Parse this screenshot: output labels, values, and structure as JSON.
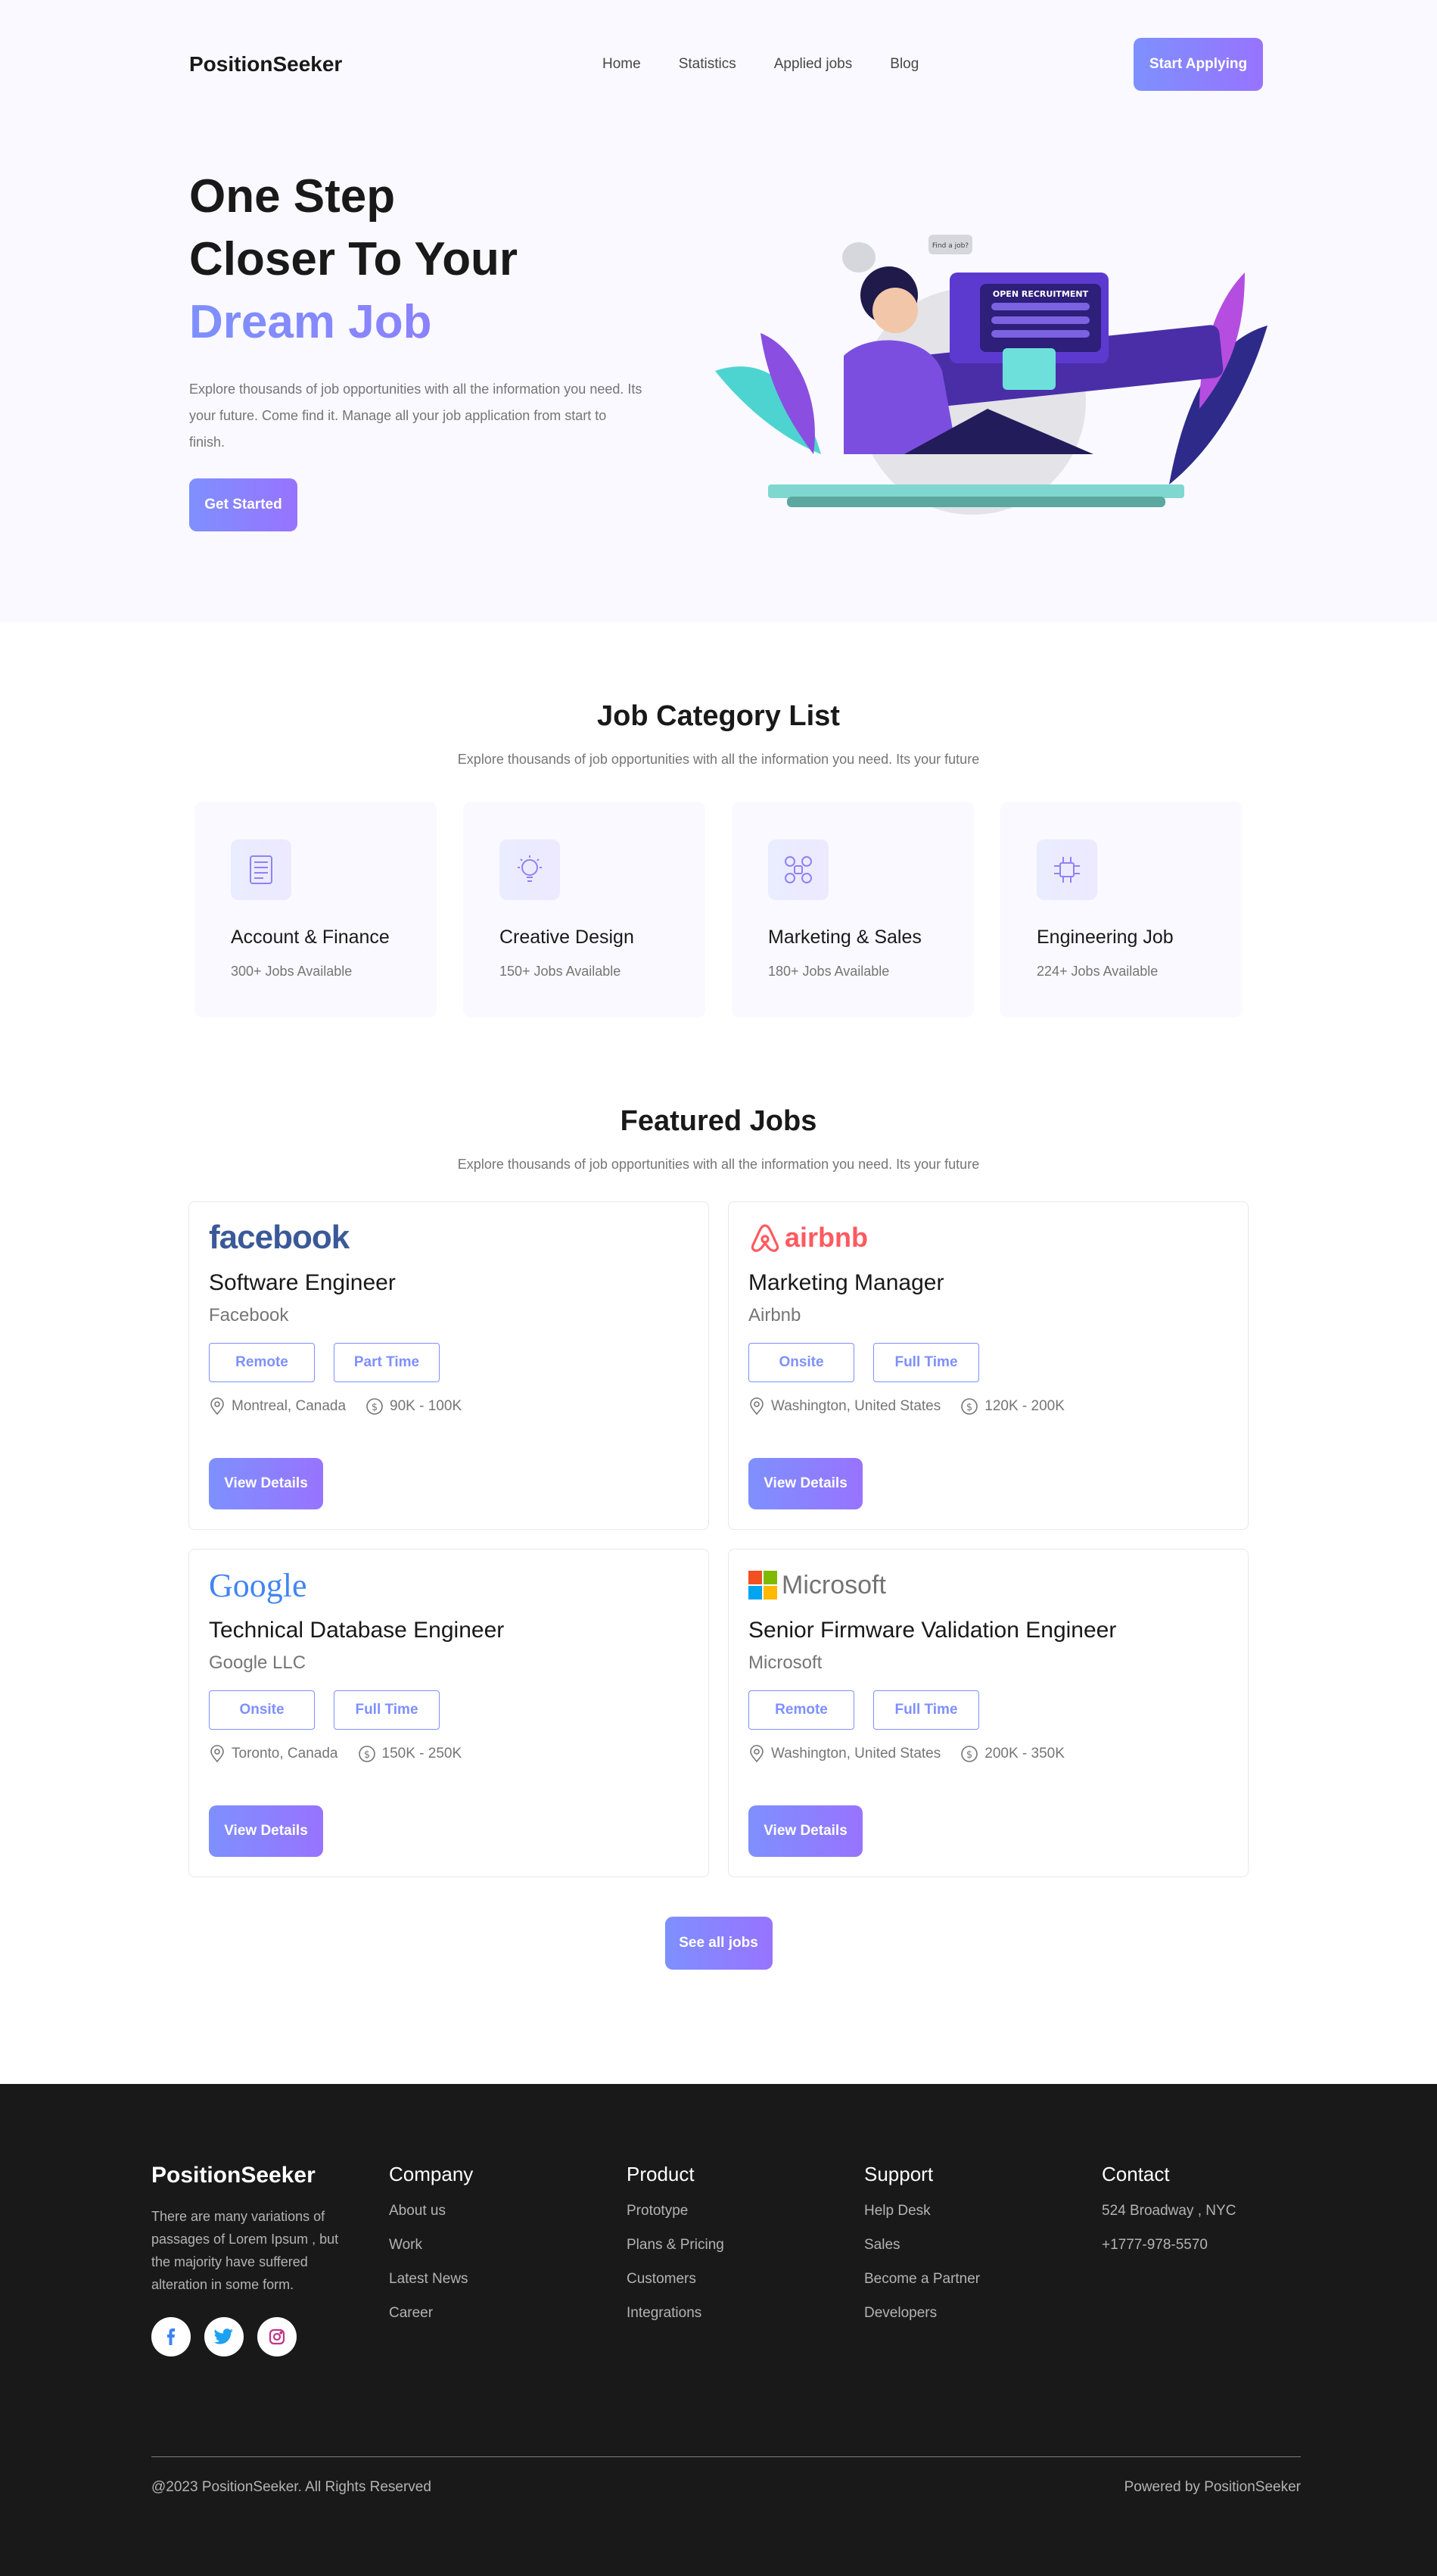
{
  "nav": {
    "brand": "PositionSeeker",
    "links": [
      "Home",
      "Statistics",
      "Applied jobs",
      "Blog"
    ],
    "cta": "Start Applying"
  },
  "hero": {
    "title_line1": "One Step",
    "title_line2": "Closer To Your",
    "title_accent": "Dream Job",
    "description": "Explore thousands of job opportunities with all the information you need. Its your future. Come find it. Manage all your job application from start to finish.",
    "button": "Get Started",
    "art_bubble_text": "Find a job?",
    "art_banner_text": "OPEN RECRUITMENT"
  },
  "categories": {
    "title": "Job Category List",
    "subtitle": "Explore thousands of job opportunities with all the information you need. Its your future",
    "items": [
      {
        "name": "Account & Finance",
        "count": "300+ Jobs Available",
        "icon": "accounts-icon"
      },
      {
        "name": "Creative Design",
        "count": "150+ Jobs Available",
        "icon": "lightbulb-icon"
      },
      {
        "name": "Marketing & Sales",
        "count": "180+ Jobs Available",
        "icon": "marketing-icon"
      },
      {
        "name": "Engineering Job",
        "count": "224+ Jobs Available",
        "icon": "chip-icon"
      }
    ]
  },
  "featured": {
    "title": "Featured Jobs",
    "subtitle": "Explore thousands of job opportunities with all the information you need. Its your future",
    "jobs": [
      {
        "logo": "facebook",
        "title": "Software Engineer",
        "company": "Facebook",
        "tags": [
          "Remote",
          "Part Time"
        ],
        "location": "Montreal, Canada",
        "salary": "90K - 100K",
        "button": "View Details"
      },
      {
        "logo": "airbnb",
        "title": "Marketing Manager",
        "company": "Airbnb",
        "tags": [
          "Onsite",
          "Full Time"
        ],
        "location": "Washington, United States",
        "salary": "120K - 200K",
        "button": "View Details"
      },
      {
        "logo": "Google",
        "title": "Technical Database Engineer",
        "company": "Google LLC",
        "tags": [
          "Onsite",
          "Full Time"
        ],
        "location": "Toronto, Canada",
        "salary": "150K - 250K",
        "button": "View Details"
      },
      {
        "logo": "Microsoft",
        "title": "Senior Firmware Validation Engineer",
        "company": "Microsoft",
        "tags": [
          "Remote",
          "Full Time"
        ],
        "location": "Washington, United States",
        "salary": "200K - 350K",
        "button": "View Details"
      }
    ],
    "see_all": "See all jobs"
  },
  "footer": {
    "brand": "PositionSeeker",
    "description": "There are many variations of passages of Lorem Ipsum , but the majority have suffered alteration in some form.",
    "columns": [
      {
        "title": "Company",
        "items": [
          "About us",
          "Work",
          "Latest News",
          "Career"
        ]
      },
      {
        "title": "Product",
        "items": [
          "Prototype",
          "Plans & Pricing",
          "Customers",
          "Integrations"
        ]
      },
      {
        "title": "Support",
        "items": [
          "Help Desk",
          "Sales",
          "Become a Partner",
          "Developers"
        ]
      },
      {
        "title": "Contact",
        "items": [
          "524 Broadway , NYC",
          "+1777-978-5570"
        ]
      }
    ],
    "copyright": "@2023 PositionSeeker. All Rights Reserved",
    "powered": "Powered by PositionSeeker"
  },
  "colors": {
    "accent_start": "#7e90fe",
    "accent_end": "#9873ff",
    "hero_bg": "#f9f9ff",
    "footer_bg": "#1a1919"
  }
}
